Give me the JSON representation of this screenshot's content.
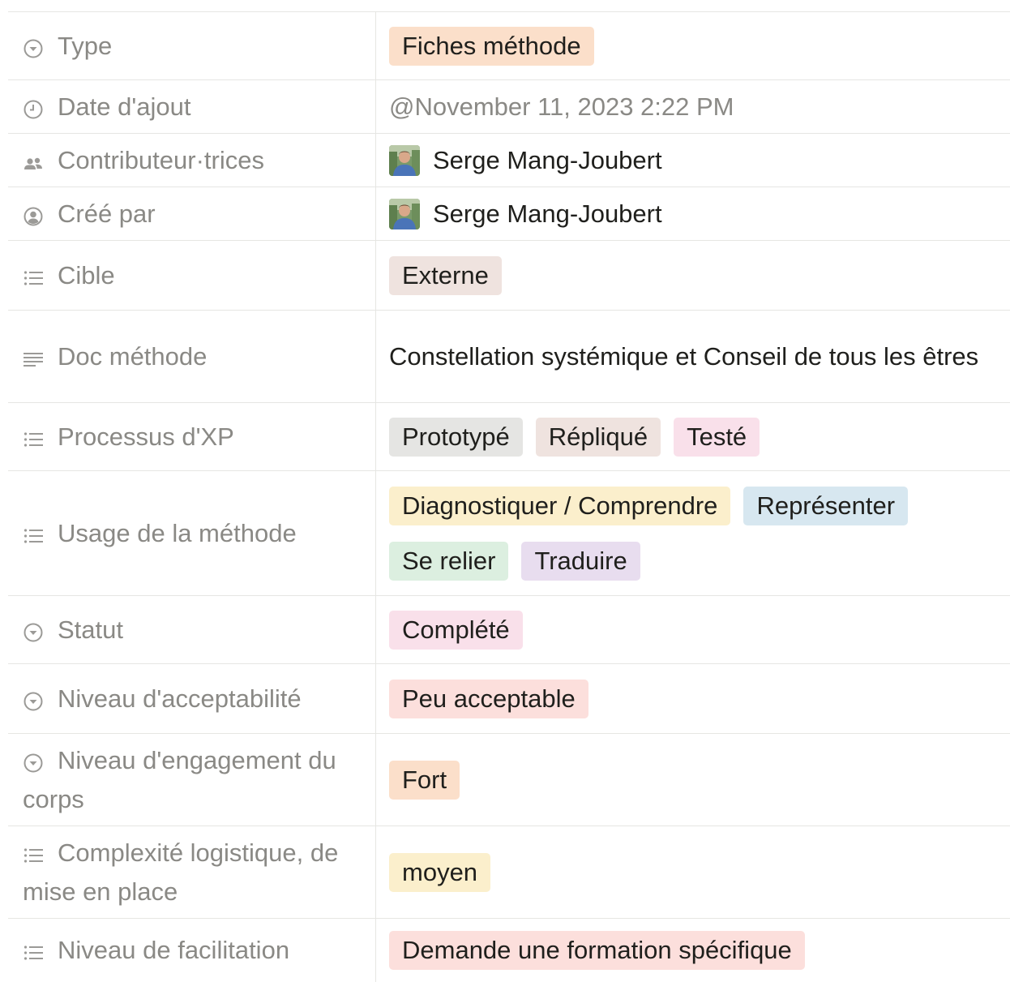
{
  "rows": [
    {
      "key": "type",
      "label": "Type",
      "icon": "select-icon",
      "kind": "tags",
      "tags": [
        {
          "text": "Fiches méthode",
          "color": "#fbdfca"
        }
      ]
    },
    {
      "key": "date",
      "label": "Date d'ajout",
      "icon": "clock-icon",
      "kind": "date",
      "value": "@November 11, 2023 2:22 PM"
    },
    {
      "key": "contributors",
      "label": "Contributeur·trices",
      "icon": "people-icon",
      "kind": "person",
      "value": "Serge Mang-Joubert"
    },
    {
      "key": "created_by",
      "label": "Créé par",
      "icon": "user-circle-icon",
      "kind": "person",
      "value": "Serge Mang-Joubert"
    },
    {
      "key": "cible",
      "label": "Cible",
      "icon": "multi-select-icon",
      "kind": "tags",
      "tags": [
        {
          "text": "Externe",
          "color": "#efe3df"
        }
      ]
    },
    {
      "key": "doc",
      "label": "Doc méthode",
      "icon": "text-icon",
      "kind": "text",
      "value": "Constellation systémique et Conseil de tous les êtres"
    },
    {
      "key": "process",
      "label": "Processus d'XP",
      "icon": "multi-select-icon",
      "kind": "tags",
      "tags": [
        {
          "text": "Prototypé",
          "color": "#e5e5e3"
        },
        {
          "text": "Répliqué",
          "color": "#efe3df"
        },
        {
          "text": "Testé",
          "color": "#f9e0ea"
        }
      ]
    },
    {
      "key": "usage",
      "label": "Usage de la méthode",
      "icon": "multi-select-icon",
      "kind": "tags",
      "tags": [
        {
          "text": "Diagnostiquer / Comprendre",
          "color": "#fbefcc"
        },
        {
          "text": "Représenter",
          "color": "#d7e7f0"
        },
        {
          "text": "Se relier",
          "color": "#dcefe0"
        },
        {
          "text": "Traduire",
          "color": "#e8ddef"
        }
      ]
    },
    {
      "key": "status",
      "label": "Statut",
      "icon": "select-icon",
      "kind": "tags",
      "tags": [
        {
          "text": "Complété",
          "color": "#f9e0ea"
        }
      ]
    },
    {
      "key": "acceptability",
      "label": "Niveau d'acceptabilité",
      "icon": "select-icon",
      "kind": "tags",
      "tags": [
        {
          "text": "Peu acceptable",
          "color": "#fcdfdc"
        }
      ]
    },
    {
      "key": "engagement",
      "label": "Niveau d'engagement du corps",
      "icon": "select-icon",
      "kind": "tags",
      "tags": [
        {
          "text": "Fort",
          "color": "#fbdfca"
        }
      ]
    },
    {
      "key": "complexity",
      "label": "Complexité logistique, de mise en place",
      "icon": "multi-select-icon",
      "kind": "tags",
      "tags": [
        {
          "text": "moyen",
          "color": "#fbefcc"
        }
      ]
    },
    {
      "key": "facilitation",
      "label": "Niveau de facilitation",
      "icon": "multi-select-icon",
      "kind": "tags",
      "tags": [
        {
          "text": "Demande une formation spécifique",
          "color": "#fcdfdc"
        }
      ]
    }
  ]
}
